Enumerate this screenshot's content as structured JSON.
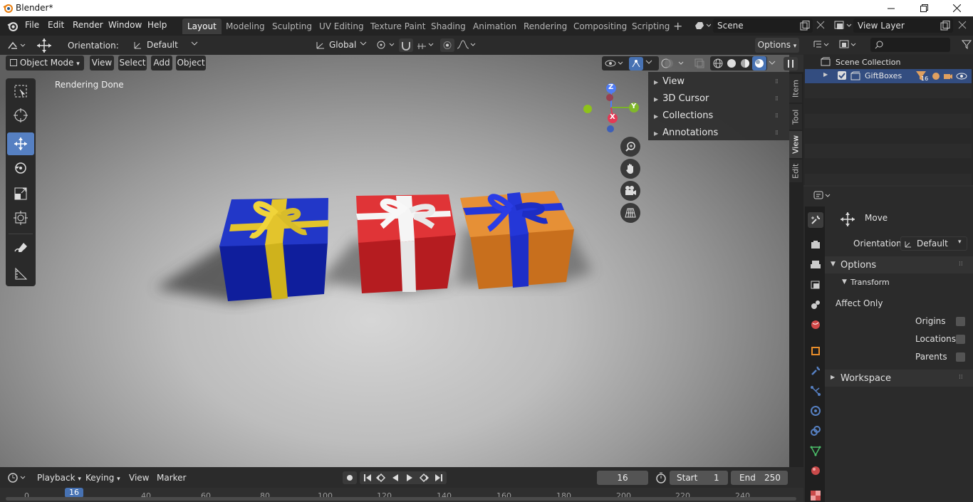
{
  "window": {
    "title": "Blender*"
  },
  "menu": {
    "file": "File",
    "edit": "Edit",
    "render": "Render",
    "window": "Window",
    "help": "Help"
  },
  "workspaces": [
    "Layout",
    "Modeling",
    "Sculpting",
    "UV Editing",
    "Texture Paint",
    "Shading",
    "Animation",
    "Rendering",
    "Compositing",
    "Scripting"
  ],
  "scene": {
    "name": "Scene",
    "view_layer": "View Layer"
  },
  "tool_header": {
    "orientation_label": "Orientation:",
    "orientation_value": "Default",
    "transform_orientation": "Global",
    "options": "Options"
  },
  "viewport": {
    "mode": "Object Mode",
    "view": "View",
    "select": "Select",
    "add": "Add",
    "object": "Object",
    "status": "Rendering Done"
  },
  "npanel": {
    "items": [
      "View",
      "3D Cursor",
      "Collections",
      "Annotations"
    ],
    "tabs": [
      "Item",
      "Tool",
      "View",
      "Edit"
    ]
  },
  "gizmo": {
    "z": "Z",
    "y": "Y",
    "x": "X"
  },
  "outliner": {
    "scene_collection": "Scene Collection",
    "collection": "GiftBoxes",
    "count": "16"
  },
  "properties": {
    "tool": "Move",
    "orientation_label": "Orientation",
    "orientation_value": "Default",
    "options": "Options",
    "transform": "Transform",
    "affect_only": "Affect Only",
    "origins": "Origins",
    "locations": "Locations",
    "parents": "Parents",
    "workspace": "Workspace"
  },
  "timeline": {
    "playback": "Playback",
    "keying": "Keying",
    "view": "View",
    "marker": "Marker",
    "current_frame": "16",
    "start_label": "Start",
    "start": "1",
    "end_label": "End",
    "end": "250",
    "ruler": [
      "0",
      "16",
      "40",
      "60",
      "80",
      "100",
      "120",
      "140",
      "160",
      "180",
      "200",
      "220",
      "240"
    ]
  },
  "colors": {
    "accent": "#5680c2",
    "active_tab": "#3d3d3d",
    "collection_highlight": "#334d80",
    "box_blue": "#1e2fb8",
    "box_red": "#d22a2c",
    "box_orange": "#d9822c",
    "ribbon_yellow": "#e0c12a"
  }
}
